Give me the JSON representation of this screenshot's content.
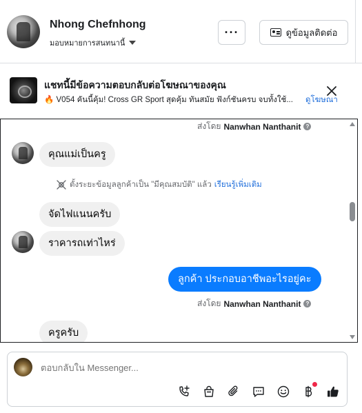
{
  "header": {
    "name": "Nhong Chefnhong",
    "assign_label": "มอบหมายการสนทนานี้",
    "more_label": "···",
    "contact_button": "ดูข้อมูลติดต่อ"
  },
  "ad_banner": {
    "title": "แชทนี้มีข้อความตอบกลับต่อโฆษณาของคุณ",
    "subtitle": "🔥 V054 คันนี้คุ้ม! Cross GR Sport สุดคุ้ม ทันสมัย ฟังก์ชันครบ จบทั้งใช้...",
    "view_ad_link": "ดูโฆษณา"
  },
  "messages": {
    "sent_by_prefix": "ส่งโดย",
    "sender_name": "Nanwhan Nanthanit",
    "items": [
      {
        "text": "คุณแม่เป็นครู"
      },
      {
        "text": "จัดไฟแนนครับ"
      },
      {
        "text": "ราคารถเท่าไหร่"
      },
      {
        "text": "ลูกค้า  ประกอบอาชีพอะไรอยู่คะ"
      },
      {
        "text": "ครูครับ"
      }
    ],
    "system_note": "ตั้งระยะข้อมูลลูกค้าเป็น \"มีคุณสมบัติ\" แล้ว",
    "learn_more": "เรียนรู้เพิ่มเติม"
  },
  "composer": {
    "placeholder": "ตอบกลับใน Messenger..."
  },
  "colors": {
    "accent": "#0a7cff",
    "link": "#216fdb",
    "notification": "#f02849"
  },
  "icons": [
    "phone-plus-icon",
    "shopping-bag-icon",
    "paperclip-icon",
    "saved-reply-icon",
    "emoji-icon",
    "baht-payment-icon",
    "thumbs-up-icon"
  ]
}
